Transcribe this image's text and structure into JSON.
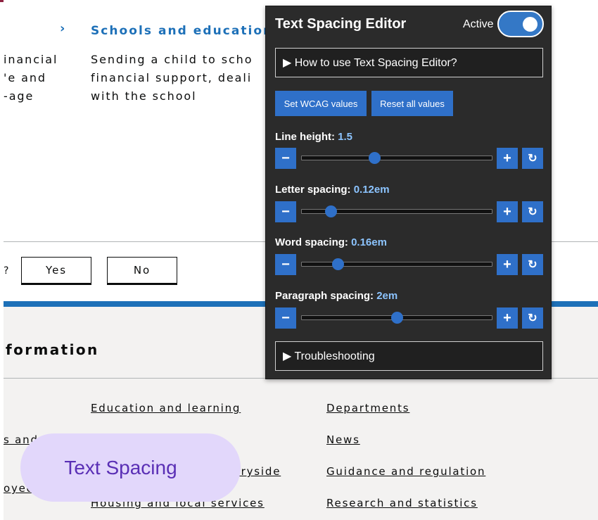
{
  "page": {
    "topic_link": "Schools and education",
    "left_fragment_lines": "inancial\n'e and\n-age",
    "description": "Sending a child to scho\nfinancial support, deali\nwith the school",
    "question_fragment": "?",
    "yes_label": "Yes",
    "no_label": "No",
    "footer_heading": "formation",
    "footer_links_col1": [
      "s and",
      "oyed"
    ],
    "footer_links_col2": [
      "Education and learning",
      "Environment and countryside",
      "Housing and local services"
    ],
    "footer_links_col3": [
      "Departments",
      "News",
      "Guidance and regulation",
      "Research and statistics"
    ]
  },
  "panel": {
    "title": "Text Spacing Editor",
    "active_label": "Active",
    "active_on": true,
    "how_to": "▶ How to use Text Spacing Editor?",
    "set_wcag": "Set WCAG values",
    "reset_all": "Reset all values",
    "controls": [
      {
        "label": "Line height:",
        "value": "1.5",
        "fraction": 0.38
      },
      {
        "label": "Letter spacing:",
        "value": "0.12em",
        "fraction": 0.15
      },
      {
        "label": "Word spacing:",
        "value": "0.16em",
        "fraction": 0.19
      },
      {
        "label": "Paragraph spacing:",
        "value": "2em",
        "fraction": 0.5
      }
    ],
    "troubleshooting": "▶ Troubleshooting",
    "minus": "−",
    "plus": "+",
    "reset_icon": "↻"
  },
  "overlay": {
    "pill_label": "Text Spacing"
  },
  "colors": {
    "accent_blue": "#2f70c9",
    "link_blue": "#1d70b8",
    "brand_rule": "#8e2241",
    "pill_bg": "#e2d7fb",
    "pill_text": "#5a2fb5"
  }
}
